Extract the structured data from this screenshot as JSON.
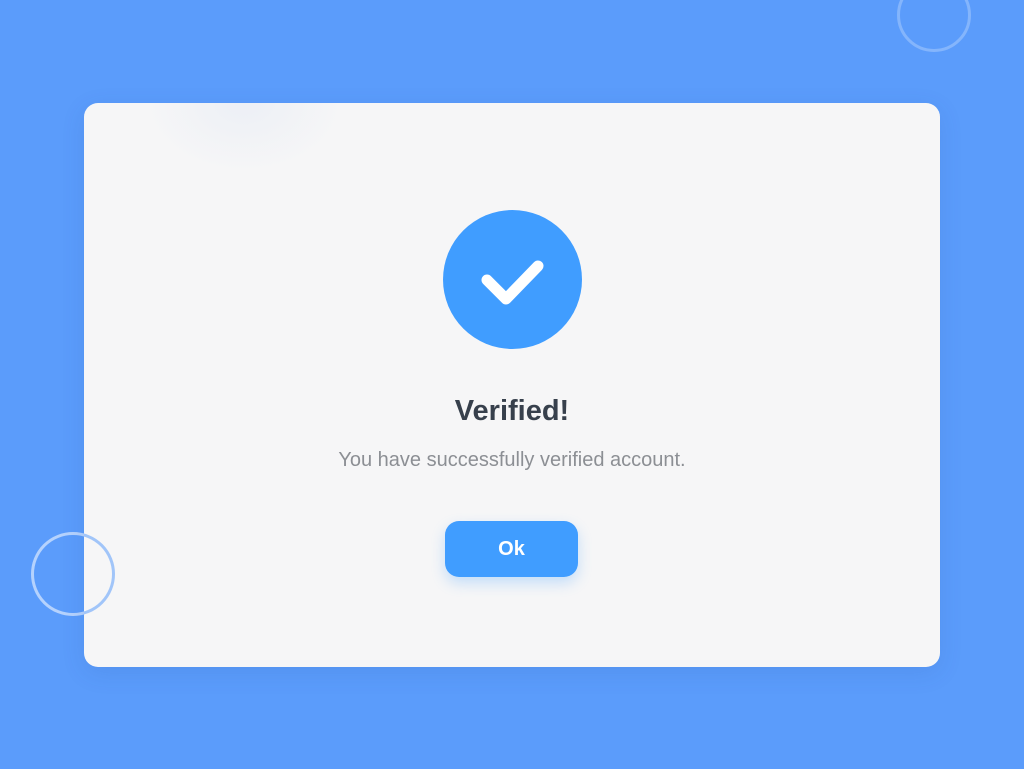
{
  "dialog": {
    "icon": "checkmark-icon",
    "title": "Verified!",
    "message": "You have successfully verified account.",
    "ok_label": "Ok"
  },
  "colors": {
    "background": "#5b9cfb",
    "card": "#f6f6f7",
    "accent": "#409dff",
    "title_text": "#37404c",
    "message_text": "#8c8f94"
  }
}
